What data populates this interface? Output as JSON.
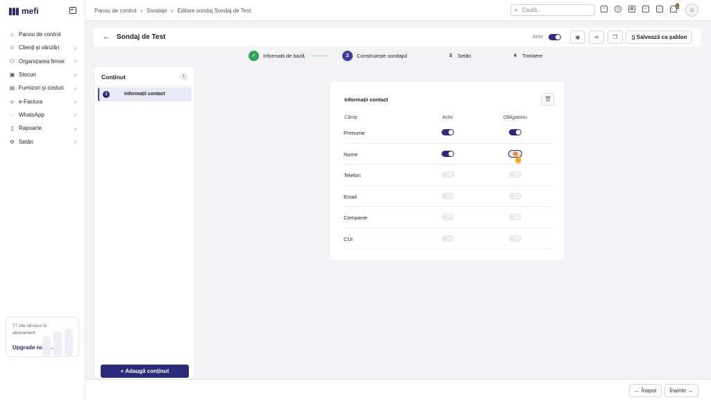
{
  "app": {
    "name": "mefi"
  },
  "sidebar": {
    "items": [
      {
        "label": "Panou de control",
        "icon": "home-icon",
        "chevron": false
      },
      {
        "label": "Clienți și vânzări",
        "icon": "users-icon",
        "chevron": true
      },
      {
        "label": "Organizarea firmei",
        "icon": "org-icon",
        "chevron": true
      },
      {
        "label": "Stocuri",
        "icon": "box-icon",
        "chevron": true
      },
      {
        "label": "Furnizori și costuri",
        "icon": "folder-icon",
        "chevron": true
      },
      {
        "label": "e-Factura",
        "icon": "efactura-icon",
        "chevron": true
      },
      {
        "label": "WhatsApp",
        "icon": "whatsapp-icon",
        "chevron": true
      },
      {
        "label": "Rapoarte",
        "icon": "clipboard-icon",
        "chevron": true
      },
      {
        "label": "Setări",
        "icon": "gear-icon",
        "chevron": true
      }
    ],
    "upgrade": {
      "text": "77 zile rămase în abonament",
      "link": "Upgrade now"
    }
  },
  "topbar": {
    "breadcrumb": [
      "Panou de control",
      "Sondaje",
      "Editare sondaj Sondaj de Test"
    ],
    "search_placeholder": "Caută...",
    "notification_count": "3"
  },
  "header": {
    "title": "Sondaj de Test",
    "active_label": "Activ",
    "save_template_label": "Salvează ca șablon"
  },
  "stepper": {
    "steps": [
      {
        "num": "✓",
        "label": "Informații de bază"
      },
      {
        "num": "2",
        "label": "Construiește sondajul"
      },
      {
        "num": "3",
        "label": "Setări"
      },
      {
        "num": "4",
        "label": "Trimitere"
      }
    ]
  },
  "content_panel": {
    "title": "Conținut",
    "count": "1",
    "items": [
      {
        "num": "1",
        "label": "Informații contact"
      }
    ],
    "add_button": "Adaugă conținut"
  },
  "contact_card": {
    "title": "Informații contact",
    "columns": {
      "field": "Câmp",
      "active": "Activ",
      "required": "Obligatoriu"
    },
    "rows": [
      {
        "label": "Prenume",
        "active": "on",
        "required": "on"
      },
      {
        "label": "Nume",
        "active": "on",
        "required": "hover"
      },
      {
        "label": "Telefon",
        "active": "off",
        "required": "off"
      },
      {
        "label": "Email",
        "active": "off",
        "required": "off"
      },
      {
        "label": "Companie",
        "active": "off",
        "required": "off"
      },
      {
        "label": "CUI",
        "active": "off",
        "required": "off"
      }
    ]
  },
  "footer": {
    "back_label": "Înapoi",
    "next_label": "Înainte"
  },
  "colors": {
    "primary": "#2a2a7a",
    "success": "#2ea65a",
    "accent": "#f08a2c"
  }
}
